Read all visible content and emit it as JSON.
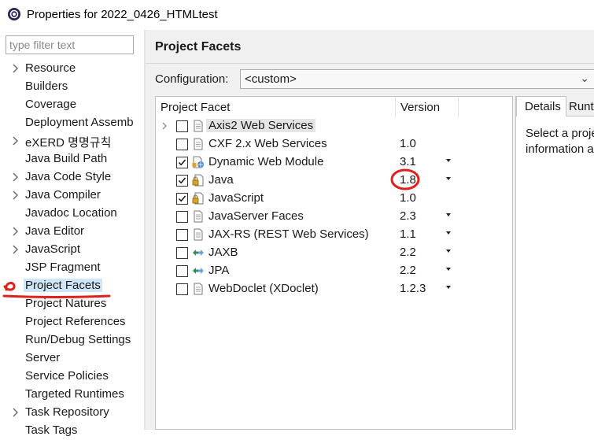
{
  "window": {
    "title": "Properties for 2022_0426_HTMLtest"
  },
  "filter": {
    "placeholder": "type filter text"
  },
  "tree": [
    {
      "label": "Resource",
      "expandable": true
    },
    {
      "label": "Builders",
      "expandable": false
    },
    {
      "label": "Coverage",
      "expandable": false
    },
    {
      "label": "Deployment Assemb",
      "expandable": false
    },
    {
      "label": "eXERD 명명규칙",
      "expandable": true
    },
    {
      "label": "Java Build Path",
      "expandable": false
    },
    {
      "label": "Java Code Style",
      "expandable": true
    },
    {
      "label": "Java Compiler",
      "expandable": true
    },
    {
      "label": "Javadoc Location",
      "expandable": false
    },
    {
      "label": "Java Editor",
      "expandable": true
    },
    {
      "label": "JavaScript",
      "expandable": true
    },
    {
      "label": "JSP Fragment",
      "expandable": false
    },
    {
      "label": "Project Facets",
      "expandable": false,
      "selected": true
    },
    {
      "label": "Project Natures",
      "expandable": false
    },
    {
      "label": "Project References",
      "expandable": false
    },
    {
      "label": "Run/Debug Settings",
      "expandable": false
    },
    {
      "label": "Server",
      "expandable": false
    },
    {
      "label": "Service Policies",
      "expandable": false
    },
    {
      "label": "Targeted Runtimes",
      "expandable": false
    },
    {
      "label": "Task Repository",
      "expandable": true
    },
    {
      "label": "Task Tags",
      "expandable": false
    }
  ],
  "page": {
    "title": "Project Facets"
  },
  "configuration": {
    "label": "Configuration:",
    "value": "<custom>"
  },
  "facets_table": {
    "headers": {
      "facet": "Project Facet",
      "version": "Version"
    },
    "rows": [
      {
        "name": "Axis2 Web Services",
        "version": "",
        "checked": false,
        "expandable": true,
        "has_dropdown": false,
        "icon": "page-icon",
        "highlighted": true
      },
      {
        "name": "CXF 2.x Web Services",
        "version": "1.0",
        "checked": false,
        "expandable": false,
        "has_dropdown": false,
        "icon": "page-icon"
      },
      {
        "name": "Dynamic Web Module",
        "version": "3.1",
        "checked": true,
        "expandable": false,
        "has_dropdown": true,
        "icon": "web-module-icon"
      },
      {
        "name": "Java",
        "version": "1.8",
        "checked": true,
        "expandable": false,
        "has_dropdown": true,
        "icon": "locked-page-icon"
      },
      {
        "name": "JavaScript",
        "version": "1.0",
        "checked": true,
        "expandable": false,
        "has_dropdown": false,
        "icon": "locked-page-icon"
      },
      {
        "name": "JavaServer Faces",
        "version": "2.3",
        "checked": false,
        "expandable": false,
        "has_dropdown": true,
        "icon": "page-icon"
      },
      {
        "name": "JAX-RS (REST Web Services)",
        "version": "1.1",
        "checked": false,
        "expandable": false,
        "has_dropdown": true,
        "icon": "page-icon"
      },
      {
        "name": "JAXB",
        "version": "2.2",
        "checked": false,
        "expandable": false,
        "has_dropdown": true,
        "icon": "arrows-icon"
      },
      {
        "name": "JPA",
        "version": "2.2",
        "checked": false,
        "expandable": false,
        "has_dropdown": true,
        "icon": "arrows-icon"
      },
      {
        "name": "WebDoclet (XDoclet)",
        "version": "1.2.3",
        "checked": false,
        "expandable": false,
        "has_dropdown": true,
        "icon": "page-icon"
      }
    ]
  },
  "details": {
    "tabs": [
      "Details",
      "Runtimes"
    ],
    "text_line1": "Select a project facet to view its details.",
    "text_line2": "information about"
  },
  "colors": {
    "selection": "#cfe6f8",
    "annotation": "#e0201a"
  }
}
